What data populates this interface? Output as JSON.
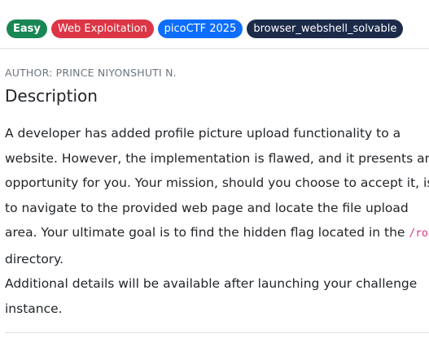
{
  "tags": [
    {
      "label": "Easy",
      "color": "#198754"
    },
    {
      "label": "Web Exploitation",
      "color": "#dc3545"
    },
    {
      "label": "picoCTF 2025",
      "color": "#0d6efd"
    },
    {
      "label": "browser_webshell_solvable",
      "color": "#1c2b4a"
    }
  ],
  "author": "AUTHOR: PRINCE NIYONSHUTI N.",
  "description": {
    "heading": "Description",
    "p1_before": "A developer has added profile picture upload functionality to a website. However, the implementation is flawed, and it presents an opportunity for you. Your mission, should you choose to accept it, is to navigate to the provided web page and locate the file upload area. Your ultimate goal is to find the hidden flag located in the ",
    "p1_code": "/root",
    "p1_after": " directory.",
    "p2": "Additional details will be available after launching your challenge instance."
  }
}
